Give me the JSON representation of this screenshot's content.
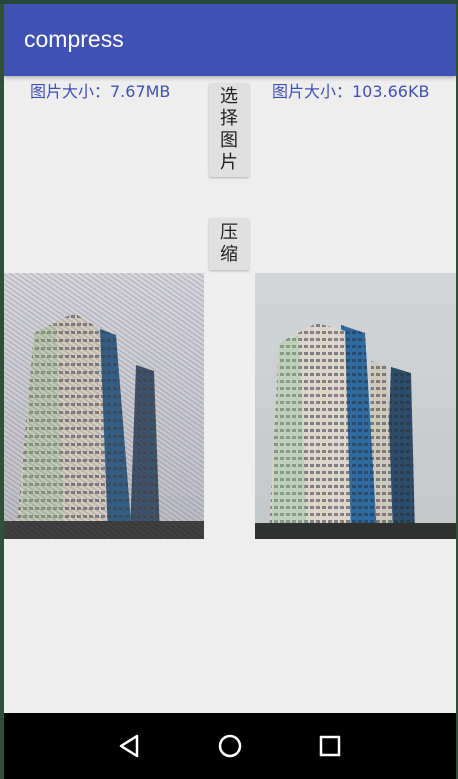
{
  "app": {
    "title": "compress"
  },
  "labels": {
    "original_size": "图片大小：7.67MB",
    "compressed_size": "图片大小：103.66KB"
  },
  "buttons": {
    "select_image": "选择图片",
    "compress": "压缩"
  },
  "images": {
    "original": "photo-original",
    "compressed": "photo-compressed"
  },
  "navbar": {
    "back_icon": "back-triangle-icon",
    "home_icon": "home-circle-icon",
    "recent_icon": "recent-square-icon"
  },
  "colors": {
    "primary": "#3f51b5",
    "background": "#eeeeee",
    "button": "#e0e0e0",
    "navbar": "#000000"
  }
}
